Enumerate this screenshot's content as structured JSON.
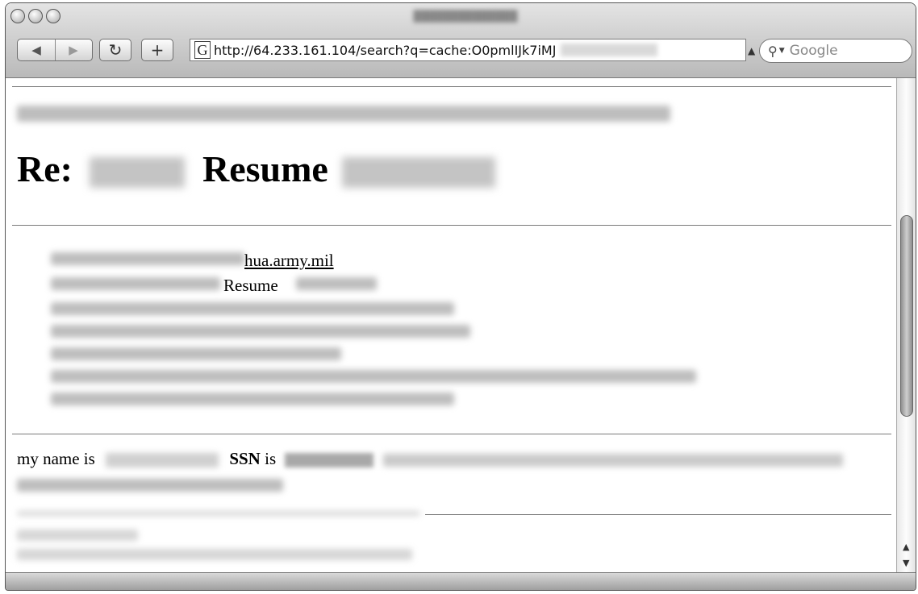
{
  "browser": {
    "url": "http://64.233.161.104/search?q=cache:O0pmlIJk7iMJ",
    "search_placeholder": "Google",
    "back_icon": "back-arrow-icon",
    "forward_icon": "forward-arrow-icon",
    "reload_icon": "reload-icon",
    "add_icon": "plus-icon"
  },
  "page": {
    "heading_prefix": "Re:",
    "heading_word": "Resume",
    "header_list": [
      {
        "visible": "hua.army.mil",
        "is_link": true
      },
      {
        "visible": "Resume",
        "is_link": false
      }
    ],
    "body": {
      "prefix": "my name is",
      "ssn_label": "SSN",
      "is_word": "is"
    }
  }
}
